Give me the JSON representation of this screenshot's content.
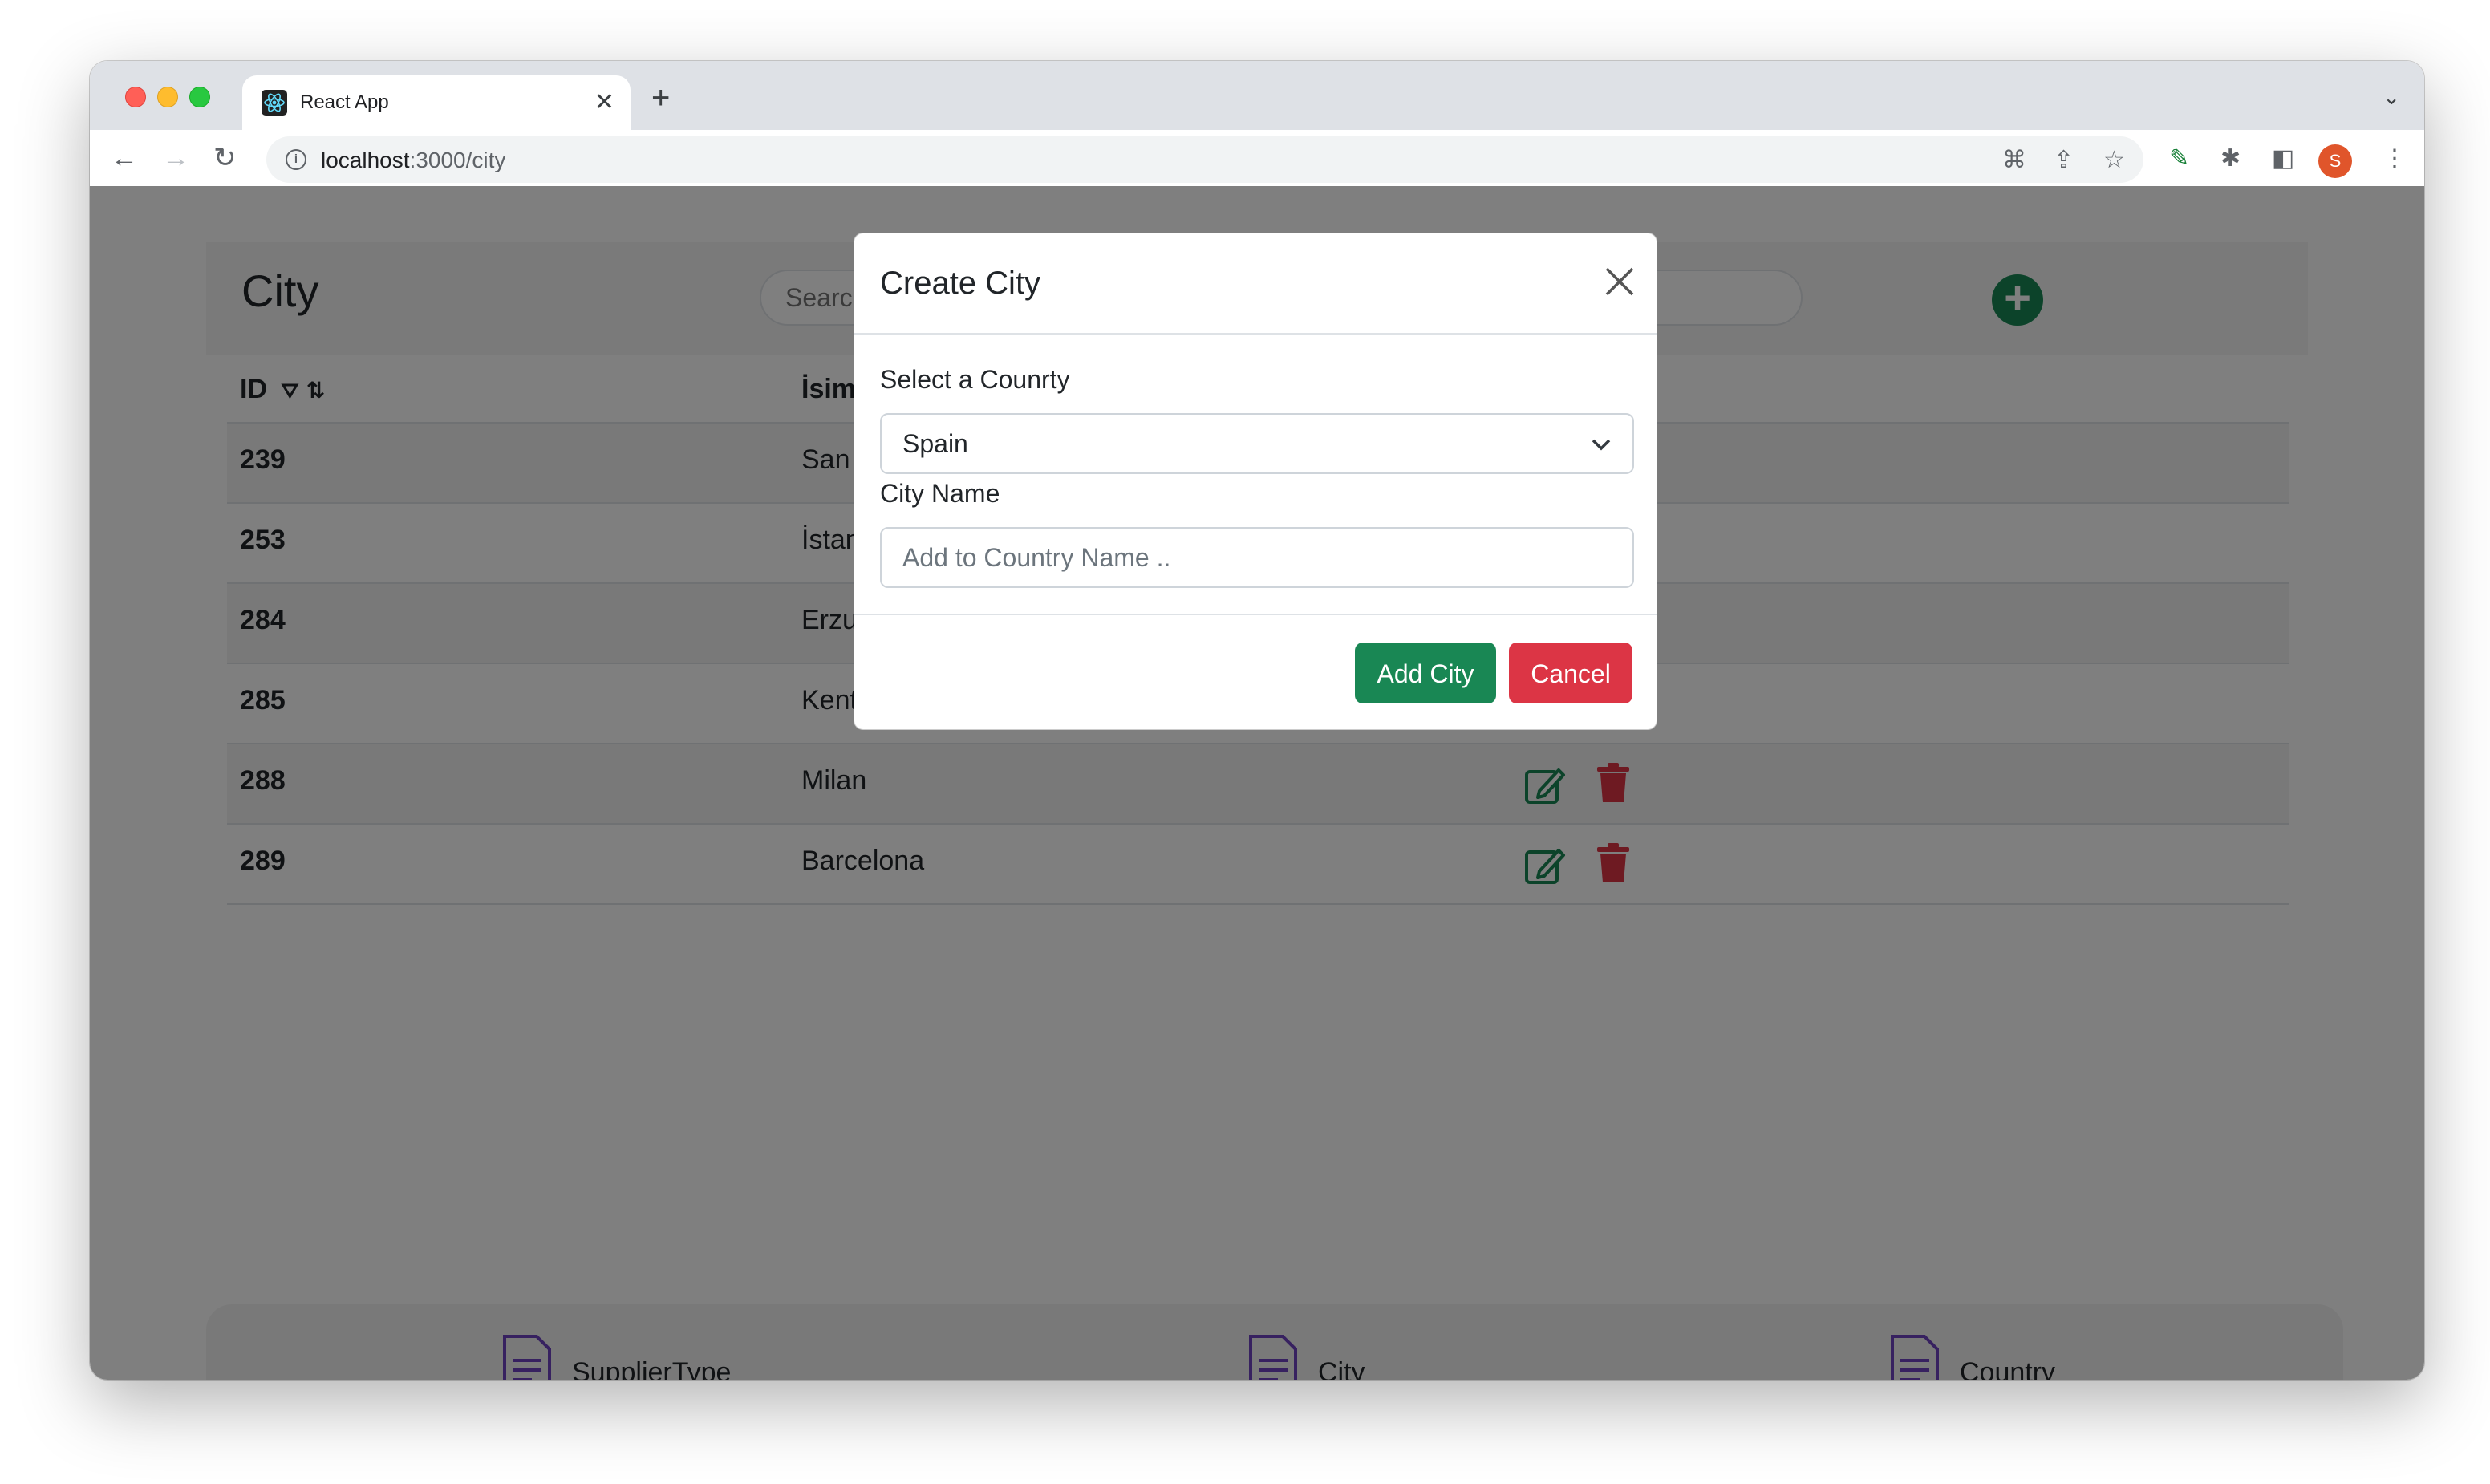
{
  "browser": {
    "tab_title": "React App",
    "tab_close": "✕",
    "new_tab": "+",
    "tabs_menu": "⌄",
    "url_host": "localhost",
    "url_path": ":3000/city",
    "nav": {
      "back": "←",
      "forward": "→",
      "reload": "↻"
    },
    "avatar_letter": "S"
  },
  "page": {
    "title": "City",
    "search_placeholder": "Search",
    "add_button": "+",
    "table": {
      "headers": [
        "ID",
        "İsim"
      ],
      "filter_icon": "⛛",
      "sort_icon": "⇅",
      "rows": [
        {
          "id": "239",
          "name": "San"
        },
        {
          "id": "253",
          "name": "İstan"
        },
        {
          "id": "284",
          "name": "Erzu"
        },
        {
          "id": "285",
          "name": "Kent"
        },
        {
          "id": "288",
          "name": "Milan"
        },
        {
          "id": "289",
          "name": "Barcelona"
        }
      ]
    },
    "footer_nav": [
      {
        "label": "SupplierType"
      },
      {
        "label": "City"
      },
      {
        "label": "Country"
      }
    ]
  },
  "modal": {
    "title": "Create City",
    "country_label": "Select a Counrty",
    "country_value": "Spain",
    "city_label": "City Name",
    "city_placeholder": "Add to Country Name ..",
    "add_button": "Add City",
    "cancel_button": "Cancel"
  },
  "colors": {
    "success": "#198754",
    "danger": "#dc3545",
    "nav_icon": "#6f42c1",
    "backdrop": "rgba(0,0,0,0.5)"
  }
}
